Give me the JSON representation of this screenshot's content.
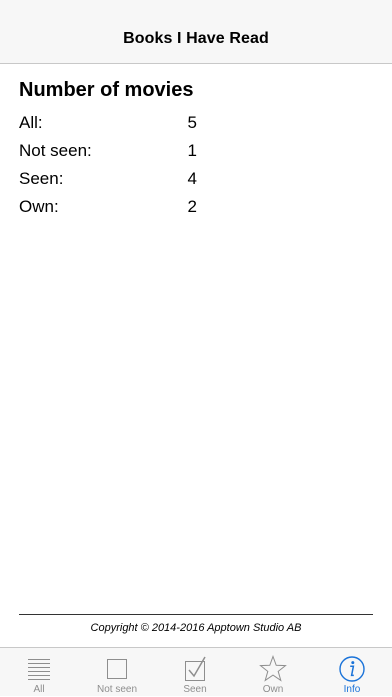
{
  "nav": {
    "title": "Books I Have Read"
  },
  "stats": {
    "heading": "Number of movies",
    "rows": [
      {
        "label": "All:",
        "value": "5"
      },
      {
        "label": "Not seen:",
        "value": "1"
      },
      {
        "label": "Seen:",
        "value": "4"
      },
      {
        "label": "Own:",
        "value": "2"
      }
    ]
  },
  "footer": {
    "copyright": "Copyright © 2014-2016 Apptown Studio AB"
  },
  "tabbar": {
    "tabs": [
      {
        "label": "All",
        "icon": "list-icon",
        "active": false
      },
      {
        "label": "Not seen",
        "icon": "empty-checkbox-icon",
        "active": false
      },
      {
        "label": "Seen",
        "icon": "checked-checkbox-icon",
        "active": false
      },
      {
        "label": "Own",
        "icon": "star-icon",
        "active": false
      },
      {
        "label": "Info",
        "icon": "info-icon",
        "active": true
      }
    ]
  },
  "colors": {
    "accent": "#1a73d9",
    "inactive": "#8e8e8e",
    "bar_background": "#f7f7f7"
  }
}
